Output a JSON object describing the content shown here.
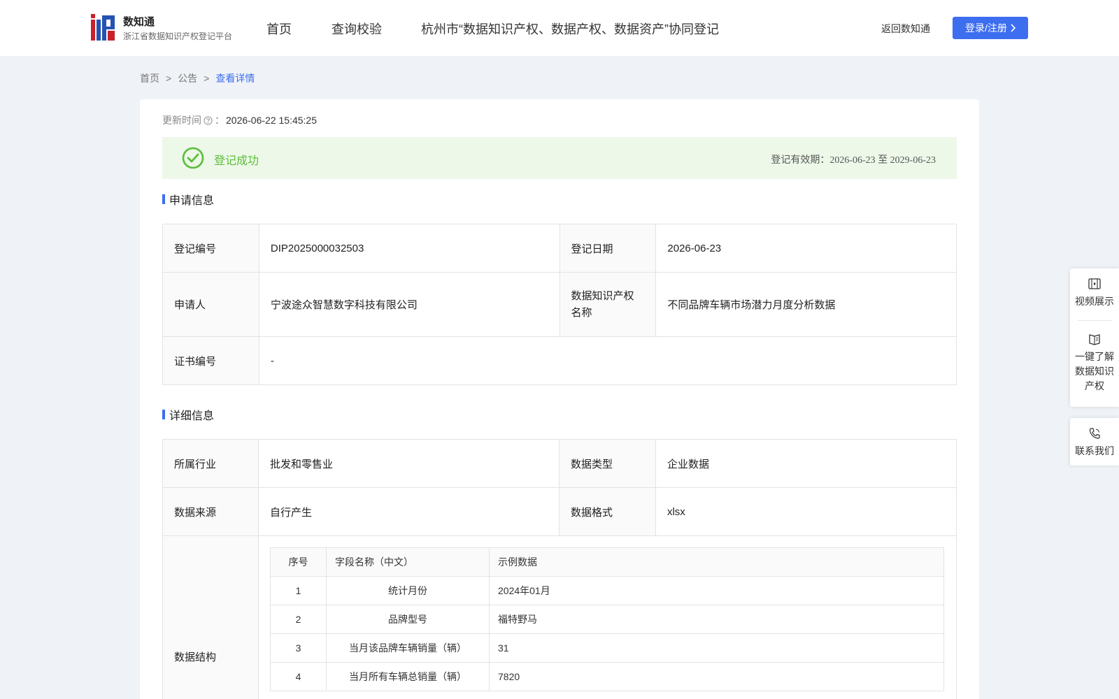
{
  "header": {
    "brand_name": "数知通",
    "brand_subtitle": "浙江省数据知识产权登记平台",
    "nav": [
      {
        "label": "首页"
      },
      {
        "label": "查询校验"
      },
      {
        "label": "杭州市“数据知识产权、数据产权、数据资产”协同登记"
      }
    ],
    "back_link": "返回数知通",
    "login_label": "登录/注册"
  },
  "breadcrumb": {
    "home": "首页",
    "notice": "公告",
    "current": "查看详情",
    "separator": ">"
  },
  "update": {
    "label": "更新时间",
    "colon": "：",
    "value": "2026-06-22 15:45:25"
  },
  "status": {
    "text": "登记成功",
    "validity": "登记有效期：2026-06-23 至 2029-06-23",
    "color": "#5bbd3a"
  },
  "application": {
    "title": "申请信息",
    "reg_no_label": "登记编号",
    "reg_no_value": "DIP2025000032503",
    "reg_date_label": "登记日期",
    "reg_date_value": "2026-06-23",
    "applicant_label": "申请人",
    "applicant_value": "宁波途众智慧数字科技有限公司",
    "ip_name_label": "数据知识产权名称",
    "ip_name_value": "不同品牌车辆市场潜力月度分析数据",
    "cert_no_label": "证书编号",
    "cert_no_value": "-"
  },
  "detail": {
    "title": "详细信息",
    "industry_label": "所属行业",
    "industry_value": "批发和零售业",
    "data_type_label": "数据类型",
    "data_type_value": "企业数据",
    "source_label": "数据来源",
    "source_value": "自行产生",
    "format_label": "数据格式",
    "format_value": "xlsx",
    "structure_label": "数据结构",
    "fields_header": {
      "no": "序号",
      "name": "字段名称（中文）",
      "sample": "示例数据"
    },
    "fields": [
      {
        "no": "1",
        "name": "统计月份",
        "sample": "2024年01月"
      },
      {
        "no": "2",
        "name": "品牌型号",
        "sample": "福特野马"
      },
      {
        "no": "3",
        "name": "当月该品牌车辆销量（辆）",
        "sample": "31"
      },
      {
        "no": "4",
        "name": "当月所有车辆总销量（辆）",
        "sample": "7820"
      }
    ]
  },
  "float_panel": {
    "video": "视频展示",
    "learn": "一键了解数据知识产权",
    "contact": "联系我们"
  },
  "colors": {
    "accent": "#3d6ef0",
    "background": "#eff2f6"
  }
}
